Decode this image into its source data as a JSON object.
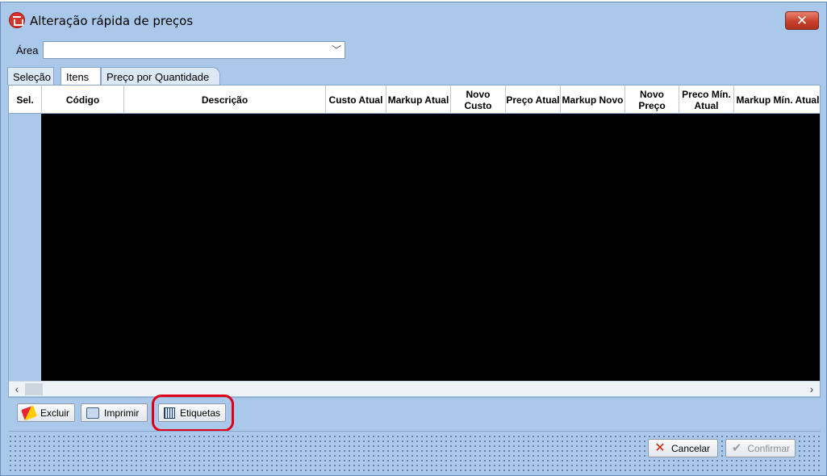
{
  "window": {
    "title": "Alteração rápida de preços",
    "close_label": "✕"
  },
  "area": {
    "label": "Área",
    "value": ""
  },
  "tabs": [
    {
      "label": "Seleção"
    },
    {
      "label": "Itens"
    },
    {
      "label": "Preço por Quantidade"
    }
  ],
  "grid": {
    "columns": [
      {
        "label": "Sel."
      },
      {
        "label": "Código"
      },
      {
        "label": "Descrição"
      },
      {
        "label": "Custo Atual"
      },
      {
        "label": "Markup Atual"
      },
      {
        "label": "Novo Custo"
      },
      {
        "label": "Preço Atual"
      },
      {
        "label": "Markup Novo"
      },
      {
        "label": "Novo Preço"
      },
      {
        "label": "Preco Mín. Atual"
      },
      {
        "label": "Markup Mín. Atual"
      }
    ]
  },
  "toolbar": {
    "excluir": "Excluir",
    "imprimir": "Imprimir",
    "etiquetas": "Etiquetas"
  },
  "footer": {
    "cancelar": "Cancelar",
    "confirmar": "Confirmar"
  }
}
